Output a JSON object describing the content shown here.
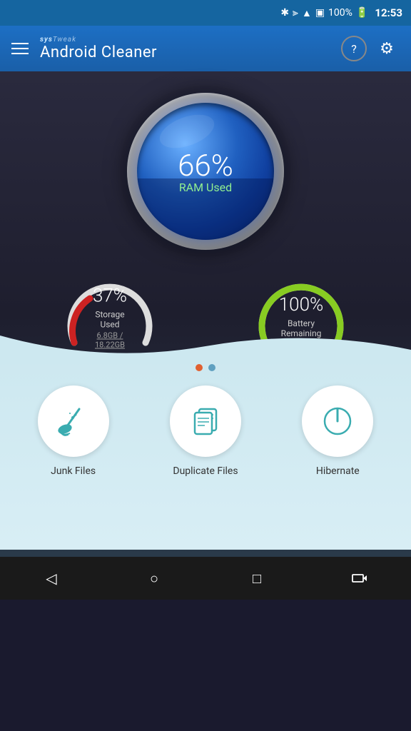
{
  "statusBar": {
    "time": "12:53",
    "battery": "100%"
  },
  "topBar": {
    "brandName": "sysTweak",
    "appTitle": "Android Cleaner",
    "helpLabel": "?",
    "settingsLabel": "⚙"
  },
  "ramGauge": {
    "percent": "66%",
    "label": "RAM Used"
  },
  "storageGauge": {
    "percent": "37%",
    "label": "Storage Used",
    "detail": "6.8GB / 18.22GB"
  },
  "batteryGauge": {
    "percent": "100%",
    "label": "Battery Remaining"
  },
  "pageIndicators": {
    "dots": [
      "active",
      "inactive"
    ]
  },
  "actions": [
    {
      "id": "junk-files",
      "label": "Junk Files"
    },
    {
      "id": "duplicate-files",
      "label": "Duplicate Files"
    },
    {
      "id": "hibernate",
      "label": "Hibernate"
    }
  ],
  "navBar": {
    "back": "◁",
    "home": "○",
    "recents": "□",
    "cast": "⬡"
  }
}
